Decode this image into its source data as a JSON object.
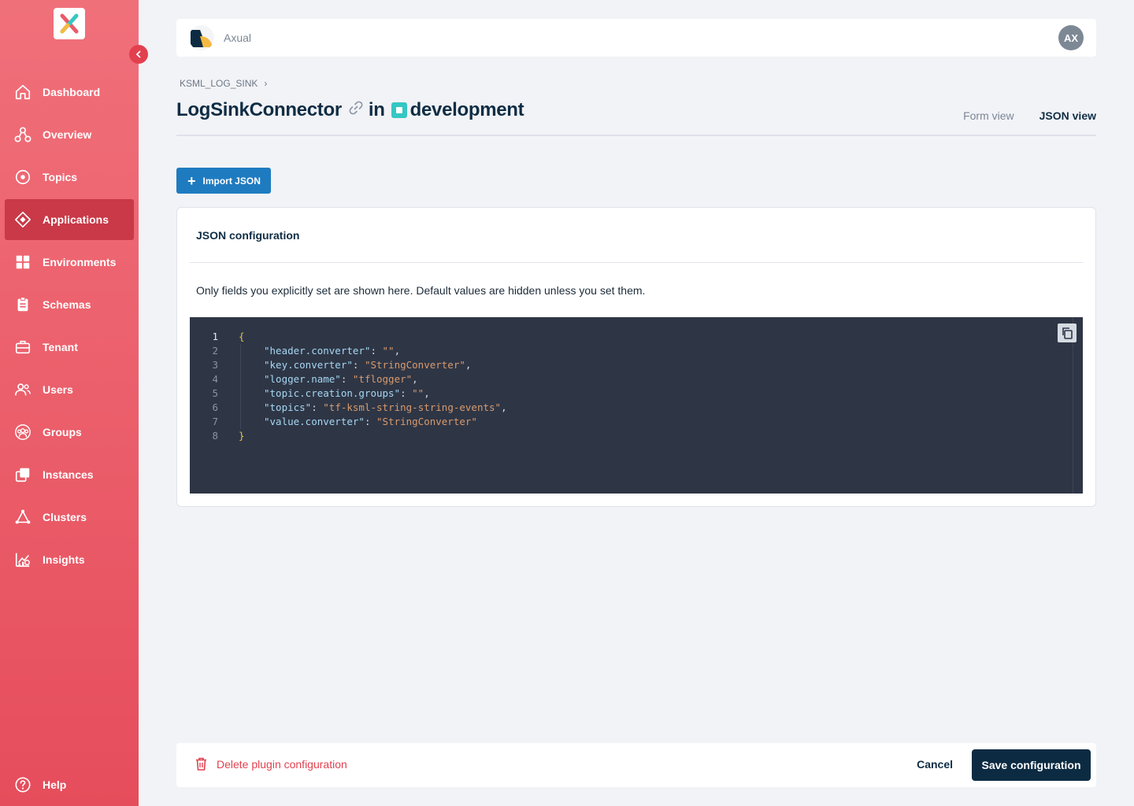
{
  "sidebar": {
    "items": [
      {
        "label": "Dashboard",
        "icon": "home-icon"
      },
      {
        "label": "Overview",
        "icon": "overview-icon"
      },
      {
        "label": "Topics",
        "icon": "topics-icon"
      },
      {
        "label": "Applications",
        "icon": "applications-icon",
        "active": true
      },
      {
        "label": "Environments",
        "icon": "environments-icon"
      },
      {
        "label": "Schemas",
        "icon": "schemas-icon"
      },
      {
        "label": "Tenant",
        "icon": "tenant-icon"
      },
      {
        "label": "Users",
        "icon": "users-icon"
      },
      {
        "label": "Groups",
        "icon": "groups-icon"
      },
      {
        "label": "Instances",
        "icon": "instances-icon"
      },
      {
        "label": "Clusters",
        "icon": "clusters-icon"
      },
      {
        "label": "Insights",
        "icon": "insights-icon"
      }
    ],
    "help_label": "Help"
  },
  "topbar": {
    "tenant_name": "Axual",
    "avatar_initials": "AX"
  },
  "breadcrumb": {
    "item": "KSML_LOG_SINK"
  },
  "title": {
    "connector": "LogSinkConnector",
    "in": "in",
    "environment": "development"
  },
  "tabs": {
    "form": "Form view",
    "json": "JSON view"
  },
  "import_button": "Import JSON",
  "card": {
    "title": "JSON configuration",
    "note": "Only fields you explicitly set are shown here. Default values are hidden unless you set them."
  },
  "editor": {
    "lines": [
      {
        "n": "1",
        "key": "",
        "value": ""
      },
      {
        "n": "2",
        "key": "\"header.converter\"",
        "value": "\"\""
      },
      {
        "n": "3",
        "key": "\"key.converter\"",
        "value": "\"StringConverter\""
      },
      {
        "n": "4",
        "key": "\"logger.name\"",
        "value": "\"tflogger\""
      },
      {
        "n": "5",
        "key": "\"topic.creation.groups\"",
        "value": "\"\""
      },
      {
        "n": "6",
        "key": "\"topics\"",
        "value": "\"tf-ksml-string-string-events\""
      },
      {
        "n": "7",
        "key": "\"value.converter\"",
        "value": "\"StringConverter\""
      },
      {
        "n": "8",
        "key": "",
        "value": ""
      }
    ],
    "open_brace": "{",
    "close_brace": "}"
  },
  "footer": {
    "delete_label": "Delete plugin configuration",
    "cancel_label": "Cancel",
    "save_label": "Save configuration"
  },
  "colors": {
    "sidebar": "#ea5b68",
    "primary": "#1f7bc0",
    "dark": "#0c2b42",
    "danger": "#e0424f",
    "editor_bg": "#2e3646"
  }
}
